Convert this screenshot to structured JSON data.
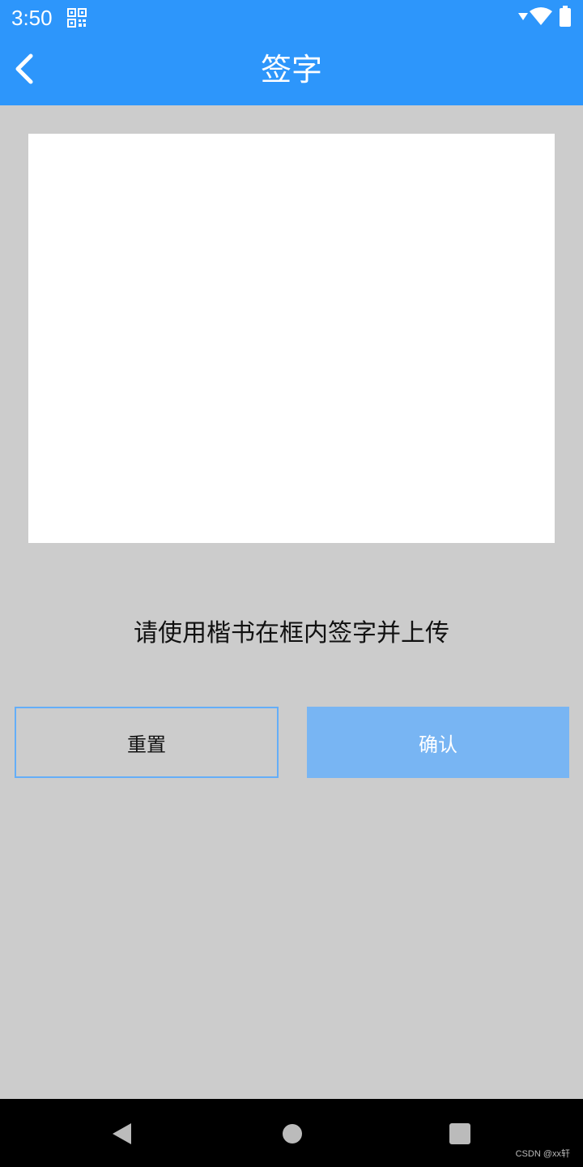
{
  "status_bar": {
    "time": "3:50",
    "icons": [
      "qr-code-icon",
      "signal-icon",
      "wifi-icon",
      "battery-icon"
    ]
  },
  "app_bar": {
    "title": "签字",
    "back_icon": "chevron-left-icon"
  },
  "signature_pad": {
    "instruction": "请使用楷书在框内签字并上传"
  },
  "buttons": {
    "reset_label": "重置",
    "confirm_label": "确认"
  },
  "nav_bar": {
    "icons": [
      "nav-back-icon",
      "nav-home-icon",
      "nav-recent-icon"
    ]
  },
  "watermark": "CSDN @xx轩",
  "colors": {
    "primary": "#2d96fb",
    "confirm_button": "#78b5f3",
    "reset_border": "#64aef8",
    "background": "#cccccc"
  }
}
